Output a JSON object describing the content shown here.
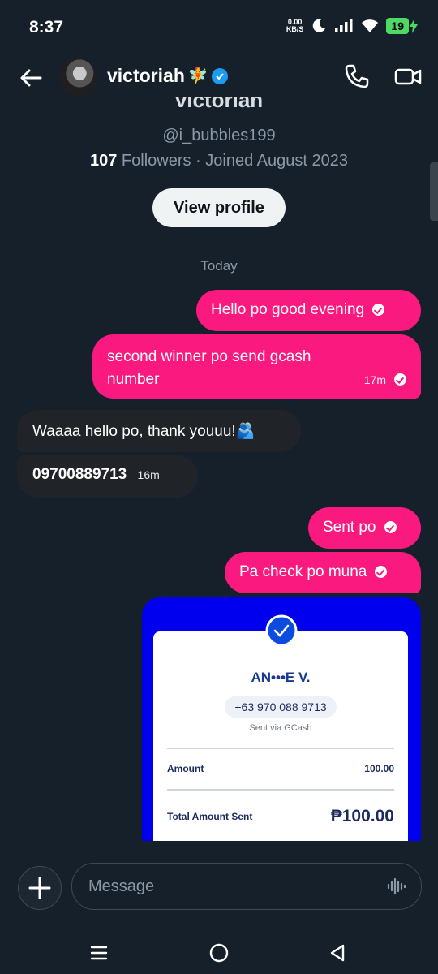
{
  "status_bar": {
    "time": "8:37",
    "net_speed_value": "0.00",
    "net_speed_unit": "KB/S",
    "battery": "19"
  },
  "header": {
    "name": "victoriah",
    "name_emoji": "🧚",
    "verified": true
  },
  "profile": {
    "cut_name": "victoriah",
    "handle": "@i_bubbles199",
    "followers_count": "107",
    "followers_label": " Followers · Joined August 2023",
    "view_profile_label": "View profile"
  },
  "conversation": {
    "date_separator": "Today",
    "messages": [
      {
        "direction": "out",
        "text": "Hello po good evening",
        "time": ""
      },
      {
        "direction": "out",
        "text_line1": "second winner po send gcash",
        "text_line2": "number",
        "time": "17m"
      },
      {
        "direction": "in",
        "text": "Waaaa hello po, thank youuu!🫂"
      },
      {
        "direction": "in",
        "text": "09700889713",
        "time": "16m"
      },
      {
        "direction": "out",
        "text": "Sent po"
      },
      {
        "direction": "out",
        "text": "Pa check po muna"
      }
    ]
  },
  "gcash_receipt": {
    "recipient": "AN•••E V.",
    "number": "+63 970 088 9713",
    "via": "Sent via GCash",
    "amount_label": "Amount",
    "amount_value": "100.00",
    "total_label": "Total Amount Sent",
    "total_value": "₱100.00",
    "brand_color": "#0000ee"
  },
  "composer": {
    "placeholder": "Message"
  },
  "colors": {
    "background": "#15202b",
    "outgoing": "#f9197f",
    "incoming": "#202327",
    "verified": "#1d9bf0"
  }
}
